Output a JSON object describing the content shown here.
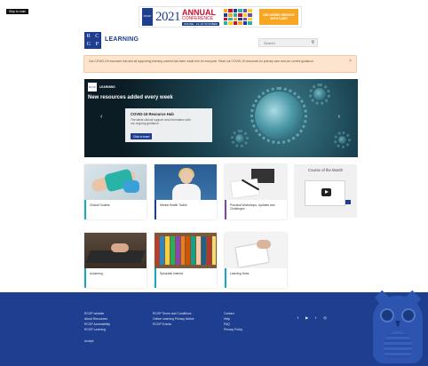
{
  "skip_link": "Skip to main",
  "banner": {
    "logo": "RCGP",
    "year": "2021",
    "annual": "ANNUAL",
    "conference": "CONFERENCE",
    "sub": "ONLINE · 14–16 OCTOBER",
    "cta": "DELIVERED SERVICE WITH CARE",
    "mosaic_colors": [
      "#f6a623",
      "#c8102e",
      "#1e3f8f",
      "#27b3a8",
      "#7a4aa1",
      "#f6d123",
      "#1e3f8f",
      "#f6a623",
      "#27b3a8",
      "#c8102e",
      "#f6d123",
      "#7a4aa1",
      "#c8102e",
      "#27b3a8",
      "#f6a623",
      "#1e3f8f",
      "#7a4aa1",
      "#f6d123",
      "#27b3a8",
      "#f6d123",
      "#c8102e",
      "#f6a623",
      "#1e3f8f",
      "#27b3a8"
    ]
  },
  "header": {
    "logo_letters": [
      "R",
      "C",
      "G",
      "P"
    ],
    "title": "LEARNING",
    "search_placeholder": "Search"
  },
  "alert": {
    "message": "Our COVID-19 resources hub and all supporting learning content has been made free for everyone. Read our COVID-19 resources for primary care and our current guidance.",
    "close": "×"
  },
  "hero": {
    "logo": "RCGP",
    "brand": "LEARNING",
    "headline": "New resources added every week",
    "card_title": "COVID-19 Resource Hub",
    "card_desc": "The latest clinical support and information with our ongoing guidance.",
    "card_button": "Click to learn",
    "prev": "‹",
    "next": "›"
  },
  "tiles": [
    {
      "caption": "Clinical Toolkits"
    },
    {
      "caption": "Mental Health Toolkit"
    },
    {
      "caption": "Practical Workshops, Updates and Challenges"
    },
    {
      "caption": "eLearning"
    },
    {
      "caption": "Specialist Interest"
    },
    {
      "caption": "Learning Hubs"
    }
  ],
  "bookshelf_colors": [
    "#c0392b",
    "#2e86c1",
    "#f4d03f",
    "#27ae60",
    "#8e44ad",
    "#e67e22",
    "#d35400",
    "#16a085",
    "#f5cba7",
    "#1f618d",
    "#b03a2e",
    "#f7dc6f"
  ],
  "course_of_month": {
    "title": "Course of the Month"
  },
  "footer": {
    "col1": [
      "RCGP website",
      "About Resources",
      "RCGP Accessibility",
      "RCGP Learning"
    ],
    "col1_extra": "Accept",
    "col2": [
      "RCGP Terms and Conditions",
      "Online Learning Privacy Notice",
      "RCGP Events"
    ],
    "col3": [
      "Contact",
      "Help",
      "FAQ",
      "Privacy Policy"
    ],
    "social": [
      "f",
      "▶",
      "t",
      "◎"
    ]
  }
}
